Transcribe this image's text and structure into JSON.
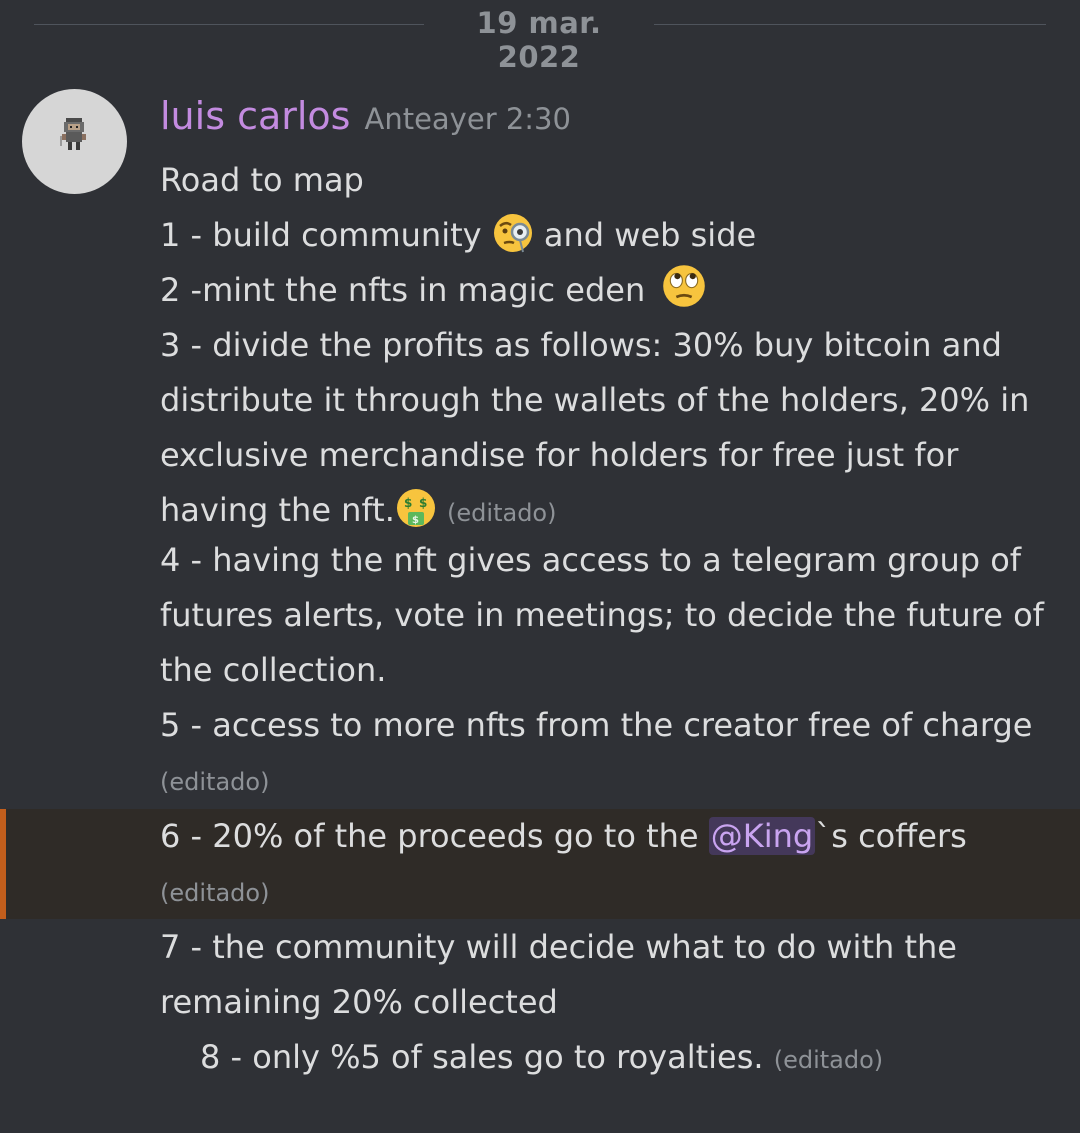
{
  "date_divider": "19 mar. 2022",
  "message": {
    "username": "luis carlos",
    "timestamp": "Anteayer 2:30",
    "edited_label": "(editado)",
    "lines": {
      "l0": "Road to map",
      "l1a": "1 - build community",
      "l1b": " and web side",
      "l2": "2 -mint the nfts in magic eden",
      "l3": "3 - divide the profits as follows: 30% buy bitcoin and",
      "l4": "distribute it through the wallets of the holders, 20% in",
      "l5": "exclusive merchandise for holders for free just for",
      "l6": "having the nft.",
      "l7": "4 - having the nft gives access to a telegram group of",
      "l8": "futures alerts, vote in meetings; to decide the future of",
      "l9": "the collection.",
      "l10": "5 - access to more nfts from the creator free of charge",
      "l11a": "6 - 20% of the proceeds go to the ",
      "mention": "@King",
      "l11b": "`s  coffers",
      "l12": "7 - the community will decide what to do with the",
      "l13": "remaining 20% collected",
      "l14": "8 - only %5 of sales go to royalties."
    },
    "emojis": [
      "face-with-monocle-icon",
      "rolling-eyes-icon",
      "money-mouth-icon"
    ]
  },
  "colors": {
    "background": "#2f3136",
    "username": "#c38be0",
    "mention_bg": "#44385a",
    "mention_text": "#c9a4f0",
    "highlight_bar": "#c25e1c"
  }
}
